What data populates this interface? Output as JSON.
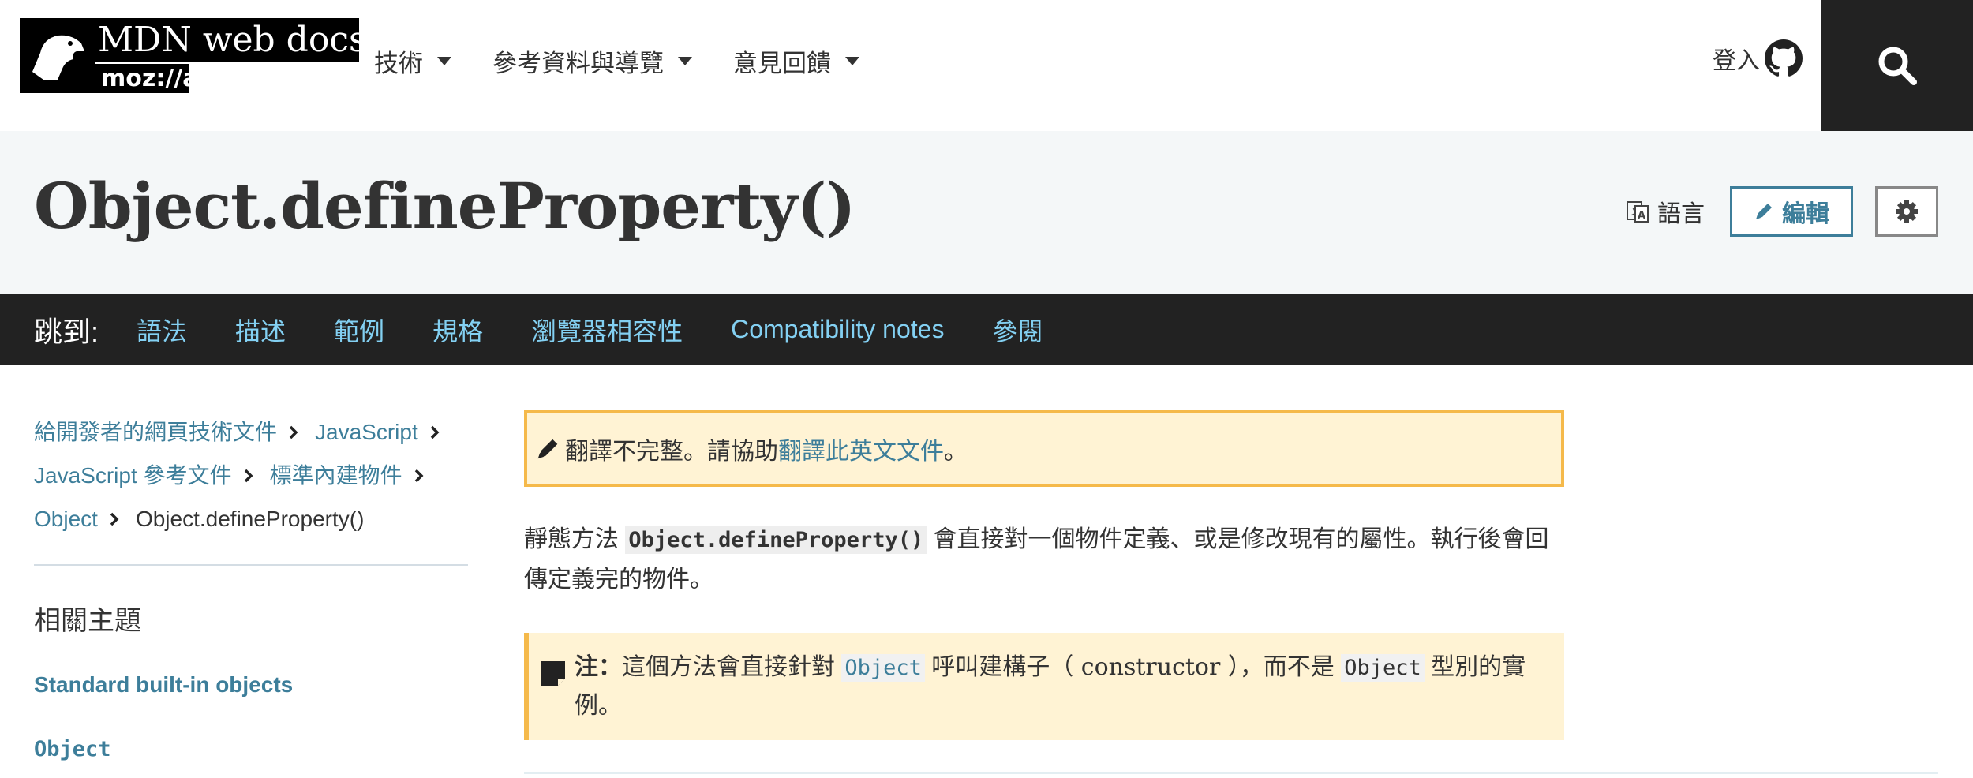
{
  "header": {
    "logo_title": "MDN web docs",
    "logo_sub": "moz://a",
    "nav": [
      {
        "label": "技術"
      },
      {
        "label": "參考資料與導覽"
      },
      {
        "label": "意見回饋"
      }
    ],
    "login_label": "登入"
  },
  "title_band": {
    "title": "Object.defineProperty()",
    "language_label": "語言",
    "edit_label": "編輯"
  },
  "jumpbar": {
    "label": "跳到:",
    "links": [
      "語法",
      "描述",
      "範例",
      "規格",
      "瀏覽器相容性",
      "Compatibility notes",
      "參閱"
    ]
  },
  "breadcrumbs": {
    "b1": "給開發者的網頁技術文件",
    "b2": "JavaScript",
    "b3": "JavaScript 參考文件",
    "b4": "標準內建物件",
    "b5": "Object",
    "current": "Object.defineProperty()"
  },
  "sidebar": {
    "related_heading": "相關主題",
    "link1": "Standard built-in objects",
    "link2": "Object"
  },
  "main": {
    "warning_text": "翻譯不完整。請協助 ",
    "warning_link": "翻譯此英文文件",
    "warning_end": "。",
    "desc_pre": "靜態方法 ",
    "desc_code": "Object.defineProperty()",
    "desc_post": " 會直接對一個物件定義、或是修改現有的屬性。執行後會回傳定義完的物件。",
    "note_label": "注：",
    "note_pre": "這個方法會直接針對 ",
    "note_code1": "Object",
    "note_mid1": " 呼叫建構子（",
    "note_constructor": " constructor ",
    "note_mid2": "），而不是 ",
    "note_code2": "Object",
    "note_post": " 型別的實例。"
  },
  "colors": {
    "link": "#3d7e9a",
    "jump_link": "#83d0f2",
    "dark": "#222222",
    "warning_border": "#f5b94a",
    "warning_bg": "#fff3d4"
  }
}
